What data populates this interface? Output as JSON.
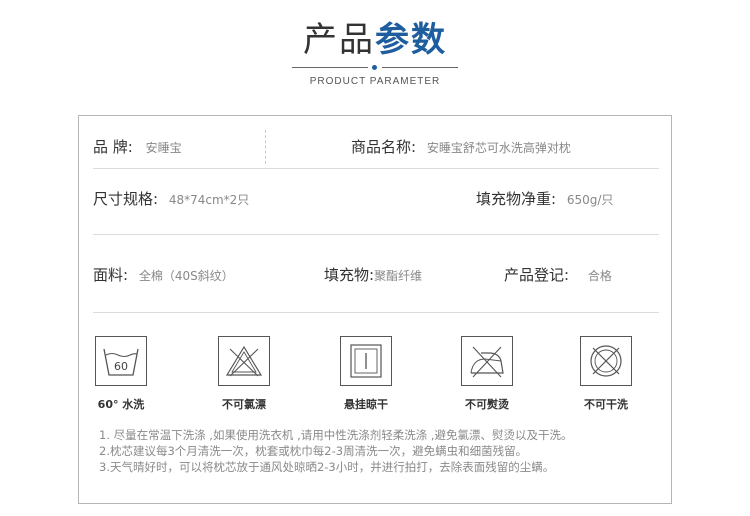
{
  "header": {
    "title_light": "产品",
    "title_bold": "参数",
    "subtitle": "PRODUCT PARAMETER"
  },
  "specs": {
    "brand_label": "品 牌:",
    "brand_value": "安睡宝",
    "name_label": "商品名称:",
    "name_value": "安睡宝舒芯可水洗高弹对枕",
    "size_label": "尺寸规格:",
    "size_value": "48*74cm*2只",
    "weight_label": "填充物净重:",
    "weight_value": "650g/只",
    "fabric_label": "面料:",
    "fabric_value": "全棉（40S斜纹）",
    "filling_label": "填充物:",
    "filling_value": "聚酯纤维",
    "reg_label": "产品登记:",
    "reg_value": "合格"
  },
  "care": {
    "wash_temp": "60",
    "items": [
      {
        "label": "60° 水洗",
        "icon": "wash-60-icon"
      },
      {
        "label": "不可氯漂",
        "icon": "no-bleach-icon"
      },
      {
        "label": "悬挂晾干",
        "icon": "hang-dry-icon"
      },
      {
        "label": "不可熨烫",
        "icon": "no-iron-icon"
      },
      {
        "label": "不可干洗",
        "icon": "no-dry-clean-icon"
      }
    ]
  },
  "notes": [
    "1. 尽量在常温下洗涤 ,如果使用洗衣机 ,请用中性洗涤剂轻柔洗涤 ,避免氯漂、熨烫以及干洗。",
    "2.枕芯建议每3个月清洗一次，枕套或枕巾每2-3周清洗一次，避免螨虫和细菌残留。",
    "3.天气晴好时，可以将枕芯放于通风处晾晒2-3小时，并进行拍打，去除表面残留的尘螨。"
  ]
}
